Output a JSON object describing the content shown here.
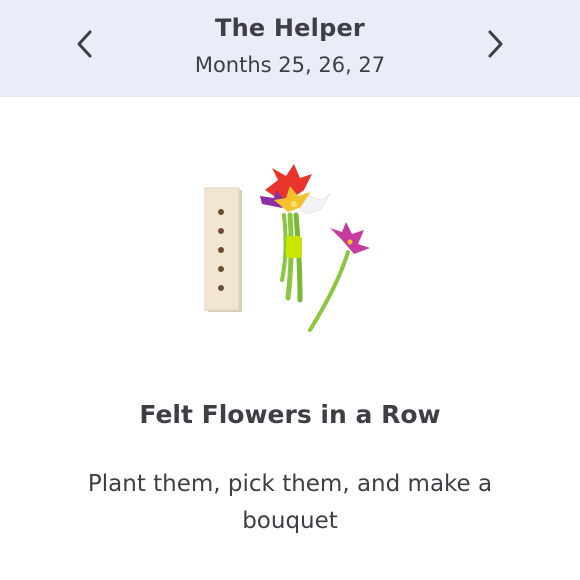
{
  "header": {
    "title": "The Helper",
    "subtitle": "Months 25, 26, 27",
    "prev_icon": "chevron-left-icon",
    "next_icon": "chevron-right-icon",
    "background": "#e8edf7"
  },
  "product": {
    "title": "Felt Flowers in a Row",
    "description": "Plant them, pick them, and make a bouquet"
  }
}
